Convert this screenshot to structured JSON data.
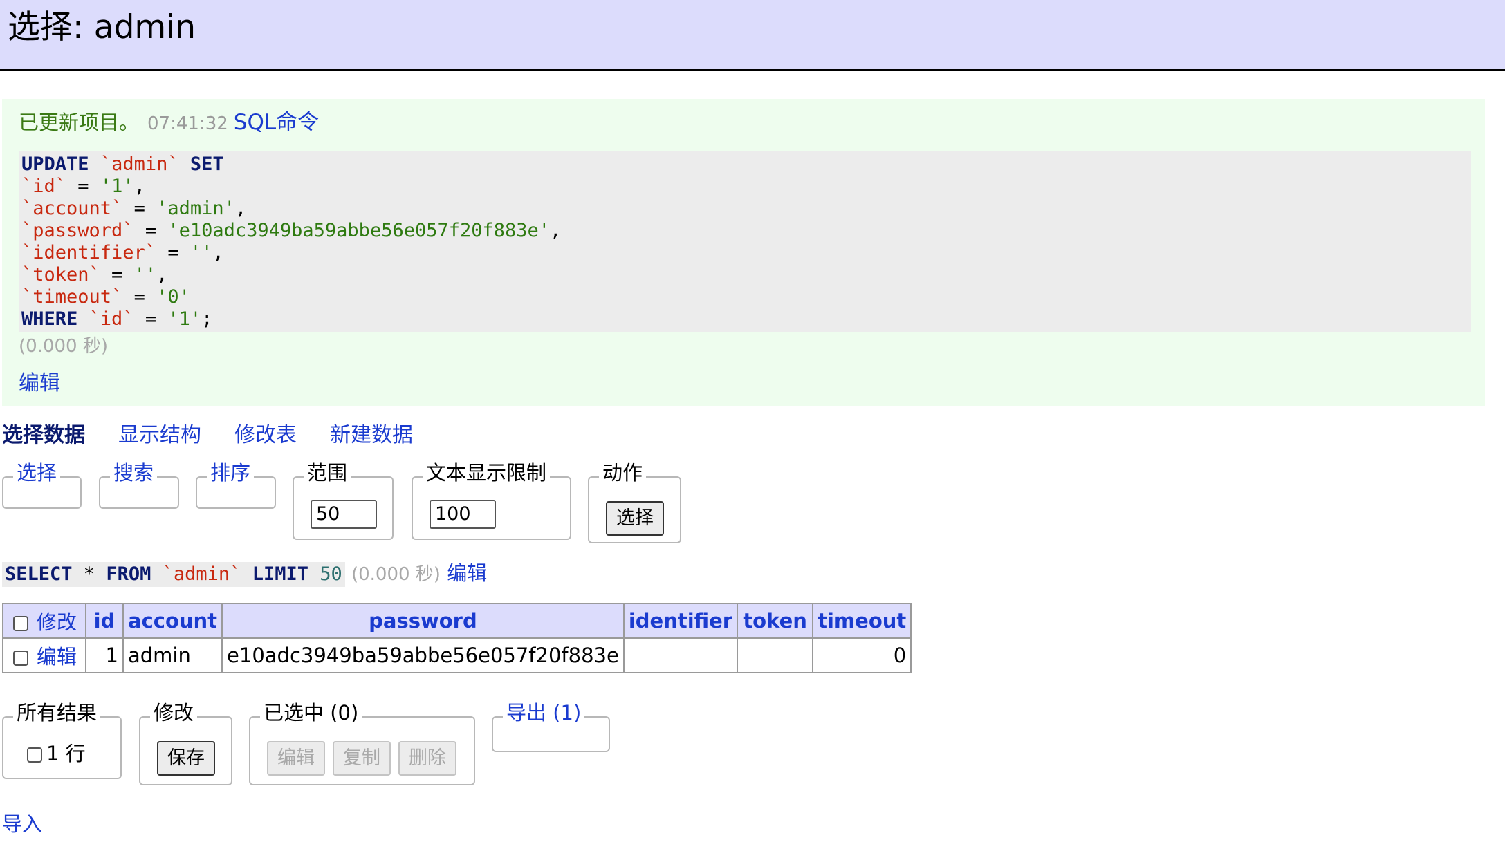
{
  "header": {
    "title": "选择: admin"
  },
  "message": {
    "status_text": "已更新项目。",
    "time": "07:41:32",
    "sql_link": "SQL命令",
    "sql": {
      "line1": {
        "kw": "UPDATE",
        "table": "`admin`",
        "kw2": "SET"
      },
      "assignments": [
        {
          "col": "`id`",
          "eq": " = ",
          "val": "'1'",
          "sep": ","
        },
        {
          "col": "`account`",
          "eq": " = ",
          "val": "'admin'",
          "sep": ","
        },
        {
          "col": "`password`",
          "eq": " = ",
          "val": "'e10adc3949ba59abbe56e057f20f883e'",
          "sep": ","
        },
        {
          "col": "`identifier`",
          "eq": " = ",
          "val": "''",
          "sep": ","
        },
        {
          "col": "`token`",
          "eq": " = ",
          "val": "''",
          "sep": ","
        },
        {
          "col": "`timeout`",
          "eq": " = ",
          "val": "'0'",
          "sep": ""
        }
      ],
      "where": {
        "kw": "WHERE",
        "col": "`id`",
        "eq": " = ",
        "val": "'1'",
        "end": ";"
      }
    },
    "duration": "(0.000 秒)",
    "edit_link": "编辑"
  },
  "tabs": [
    {
      "label": "选择数据",
      "active": true
    },
    {
      "label": "显示结构"
    },
    {
      "label": "修改表"
    },
    {
      "label": "新建数据"
    }
  ],
  "filters": {
    "select_legend": "选择",
    "search_legend": "搜索",
    "sort_legend": "排序",
    "range_legend": "范围",
    "range_value": "50",
    "text_limit_legend": "文本显示限制",
    "text_limit_value": "100",
    "action_legend": "动作",
    "action_button": "选择"
  },
  "query": {
    "kw1": "SELECT",
    "star": " * ",
    "kw2": "FROM",
    "table": "`admin`",
    "kw3": "LIMIT",
    "limit": "50",
    "duration": "(0.000 秒)",
    "edit_link": "编辑"
  },
  "table": {
    "headers": {
      "modify": "修改",
      "id": "id",
      "account": "account",
      "password": "password",
      "identifier": "identifier",
      "token": "token",
      "timeout": "timeout"
    },
    "rows": [
      {
        "edit": "编辑",
        "id": "1",
        "account": "admin",
        "password": "e10adc3949ba59abbe56e057f20f883e",
        "identifier": "",
        "token": "",
        "timeout": "0"
      }
    ]
  },
  "bottom": {
    "all_results_legend": "所有结果",
    "rows_label": "1 行",
    "modify_legend": "修改",
    "save_button": "保存",
    "selected_legend": "已选中 (0)",
    "edit_button": "编辑",
    "copy_button": "复制",
    "delete_button": "删除",
    "export_legend": "导出 (1)"
  },
  "import_link": "导入",
  "colors": {
    "header_bg": "#dcdcfc",
    "message_bg": "#eefdee",
    "link": "#1a3bcf",
    "keyword": "#0b1a6e",
    "identifier": "#c8280f",
    "string": "#2e7a10"
  }
}
